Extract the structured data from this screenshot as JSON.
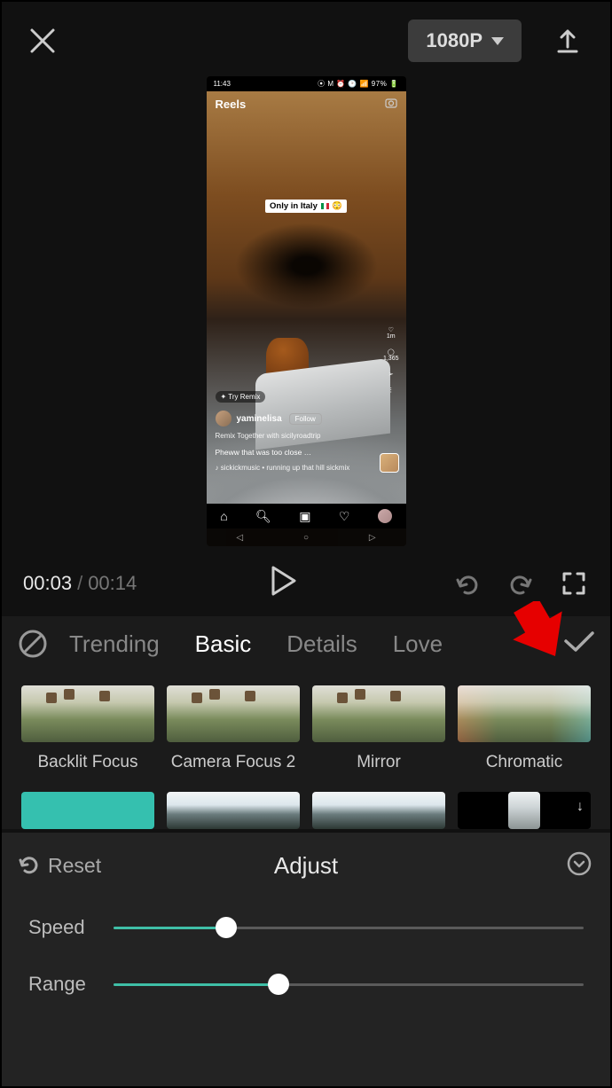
{
  "header": {
    "resolution_label": "1080P"
  },
  "preview": {
    "statusbar_time": "11:43",
    "statusbar_icons": "⦿ M    ⏰ 🕑 📶 97% 🔋",
    "reels_label": "Reels",
    "overlay_text": "Only in Italy",
    "likes_count": "1m",
    "comments_count": "1,365",
    "remix_label": "✦ Try Remix",
    "username": "yaminelisa",
    "follow_label": "Follow",
    "caption_remix": "Remix Together with sicilyroadtrip",
    "caption_main": "Pheww that was too close …",
    "caption_audio": "♪ sickickmusic • running up that hill sickmix"
  },
  "transport": {
    "current_time": "00:03",
    "total_time": "00:14"
  },
  "categories": {
    "items": [
      "Trending",
      "Basic",
      "Details",
      "Love"
    ],
    "active_index": 1
  },
  "effects_row1": [
    {
      "label": "Backlit Focus"
    },
    {
      "label": "Camera Focus 2"
    },
    {
      "label": "Mirror"
    },
    {
      "label": "Chromatic"
    }
  ],
  "adjust": {
    "reset_label": "Reset",
    "title": "Adjust",
    "sliders": [
      {
        "label": "Speed",
        "percent": 24
      },
      {
        "label": "Range",
        "percent": 35
      }
    ]
  }
}
